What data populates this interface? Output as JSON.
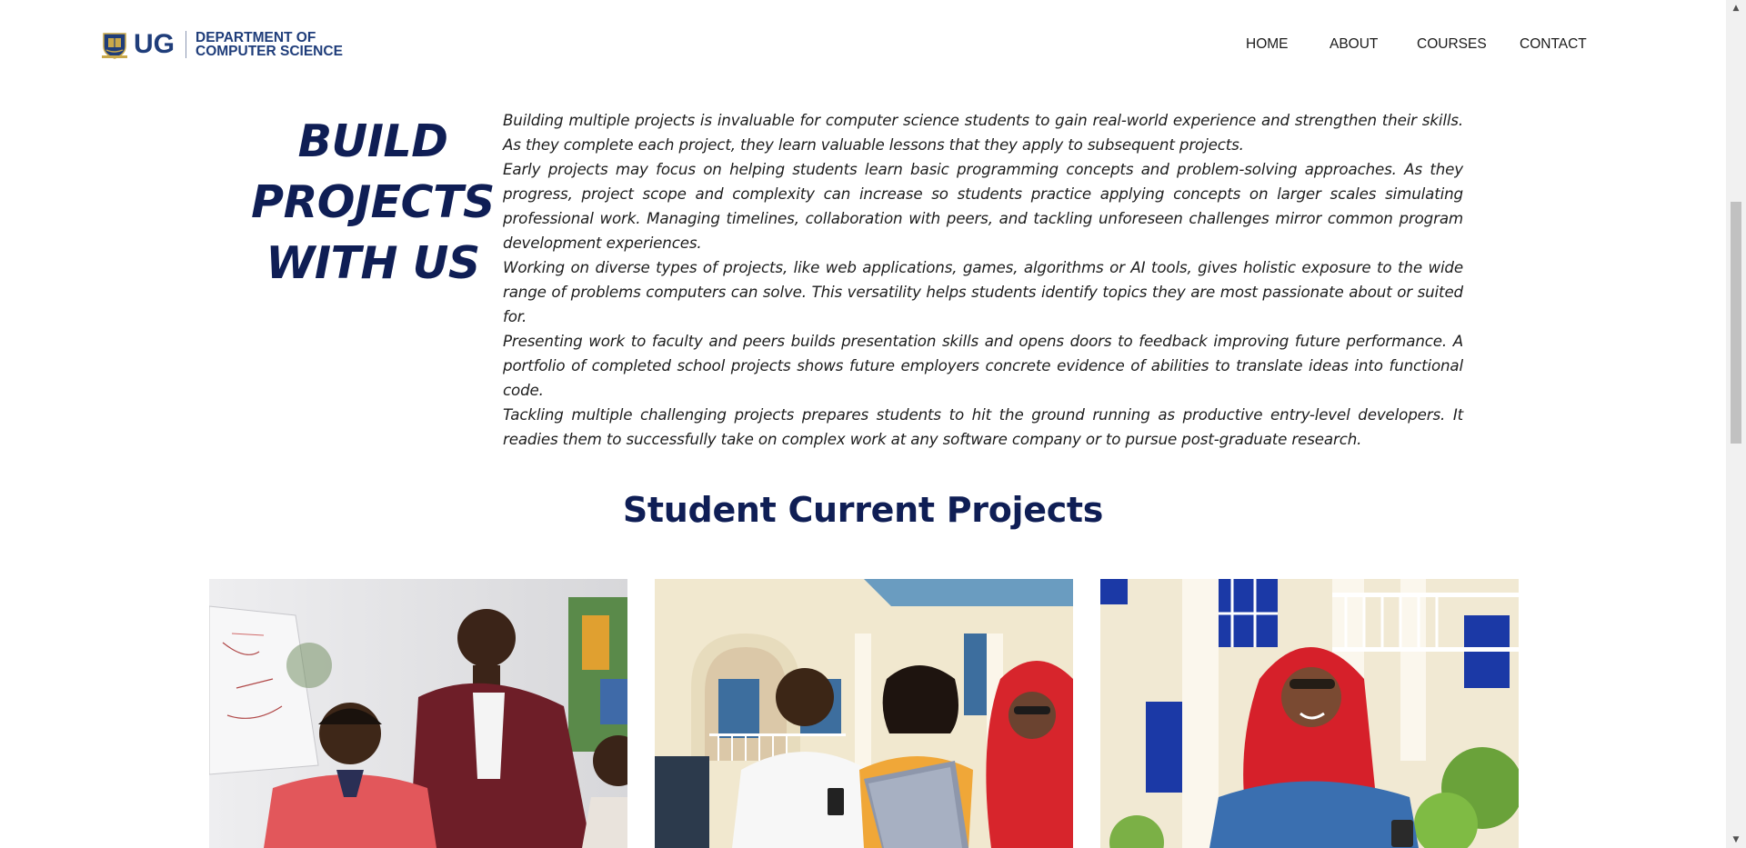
{
  "header": {
    "logo": {
      "short": "UG",
      "line1": "DEPARTMENT OF",
      "line2": "COMPUTER SCIENCE"
    },
    "nav": [
      "HOME",
      "ABOUT",
      "COURSES",
      "CONTACT"
    ]
  },
  "intro": {
    "title_lines": [
      "BUILD",
      "PROJECTS",
      "WITH US"
    ],
    "paragraphs": [
      "Building multiple projects is invaluable for computer science students to gain real-world experience and strengthen their skills. As they complete each project, they learn valuable lessons that they apply to subsequent projects.",
      "Early projects may focus on helping students learn basic programming concepts and problem-solving approaches. As they progress, project scope and complexity can increase so students practice applying concepts on larger scales simulating professional work. Managing timelines, collaboration with peers, and tackling unforeseen challenges mirror common program development experiences.",
      "Working on diverse types of projects, like web applications, games, algorithms or AI tools, gives holistic exposure to the wide range of problems computers can solve. This versatility helps students identify topics they are most passionate about or suited for.",
      "Presenting work to faculty and peers builds presentation skills and opens doors to feedback improving future performance. A portfolio of completed school projects shows future employers concrete evidence of abilities to translate ideas into functional code.",
      "Tackling multiple challenging projects prepares students to hit the ground running as productive entry-level developers. It readies them to successfully take on complex work at any software company or to pursue post-graduate research."
    ]
  },
  "projects": {
    "heading": "Student Current Projects",
    "cards": [
      {
        "image": "students-working-with-mentor-photo"
      },
      {
        "image": "students-with-laptop-outdoors-photo"
      },
      {
        "image": "student-with-phone-outdoors-photo"
      }
    ]
  },
  "colors": {
    "heading_navy": "#0f1e55",
    "logo_blue": "#1f3d7a",
    "body_text": "#1d1d1d"
  }
}
